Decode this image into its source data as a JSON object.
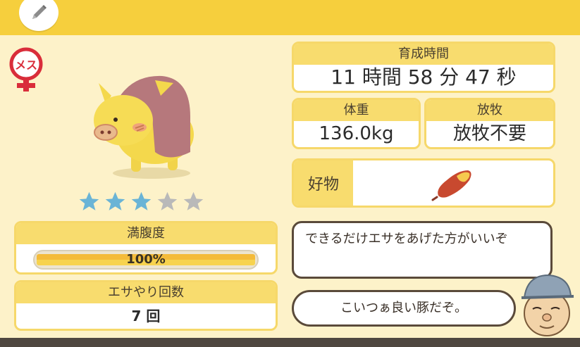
{
  "header": {
    "edit_icon": "pencil-icon"
  },
  "gender": {
    "label": "メス",
    "icon": "female-symbol-icon",
    "color": "#d92d3a"
  },
  "rating": {
    "value": 3,
    "max": 5,
    "filled_color": "#6ab4d6",
    "empty_color": "#b9b9b9"
  },
  "stats": {
    "growth_time": {
      "label": "育成時間",
      "value": "11 時間 58 分 47 秒"
    },
    "weight": {
      "label": "体重",
      "value": "136.0kg"
    },
    "grazing": {
      "label": "放牧",
      "value": "放牧不要"
    },
    "favorite": {
      "label": "好物",
      "item_icon": "sweet-potato-icon"
    },
    "fullness": {
      "label": "満腹度",
      "value": "100%",
      "percent": 100
    },
    "feed_count": {
      "label": "エサやり回数",
      "value": "7 回"
    }
  },
  "speech": {
    "line1": "できるだけエサをあげた方がいいぞ",
    "line2": "こいつぁ良い豚だぞ。"
  }
}
